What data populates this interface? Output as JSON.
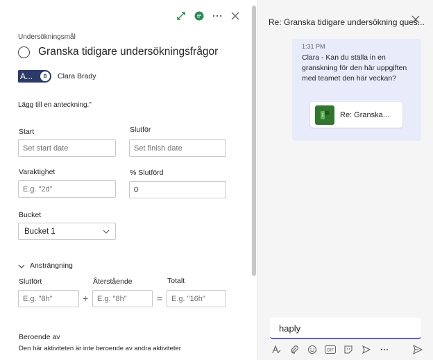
{
  "task": {
    "section_label": "Undersökningsmål",
    "title": "Granska tidigare undersökningsfrågor",
    "assignee": {
      "chip_text": "A...",
      "avatar_initial": "B",
      "name": "Clara Brady"
    },
    "note_link": "Lägg till en anteckning.\"",
    "fields": {
      "start_label": "Start",
      "start_placeholder": "Set start date",
      "finish_label": "Slutför",
      "finish_placeholder": "Set finish date",
      "duration_label": "Varaktighet",
      "duration_placeholder": "E.g. \"2d\"",
      "percent_label": "% Slutförd",
      "percent_value": "0",
      "bucket_label": "Bucket",
      "bucket_value": "Bucket 1"
    },
    "effort": {
      "toggle_label": "Ansträngning",
      "completed_label": "Slutfört",
      "completed_placeholder": "E.g. \"8h\"",
      "remaining_label": "Återstående",
      "remaining_placeholder": "E.g. \"8h\"",
      "total_label": "Totalt",
      "total_placeholder": "E.g. \"16h\"",
      "plus": "+",
      "equals": "="
    },
    "dependencies": {
      "label": "Beroende av",
      "text": "Den här aktiviteten är inte beroende av andra aktiviteter"
    },
    "toolbar_icons": [
      "expand-icon",
      "chat-icon",
      "more-icon",
      "close-icon"
    ]
  },
  "chat": {
    "header_title": "Re: Granska tidigare undersökning ques...",
    "message": {
      "time": "1:31 PM",
      "text": "Clara - Kan du ställa in en granskning för den här uppgiften med teamet den här veckan?",
      "card_title": "Re: Granska..."
    },
    "compose_text": "haply",
    "compose_tools": [
      "format-icon",
      "attach-icon",
      "emoji-icon",
      "gif-icon",
      "sticker-icon",
      "schedule-icon",
      "more-icon",
      "send-icon"
    ]
  },
  "colors": {
    "accent": "#5b5fc7",
    "bubble": "#e8ebfa",
    "planner_green": "#31752f",
    "assignee_chip": "#2b3a67"
  }
}
